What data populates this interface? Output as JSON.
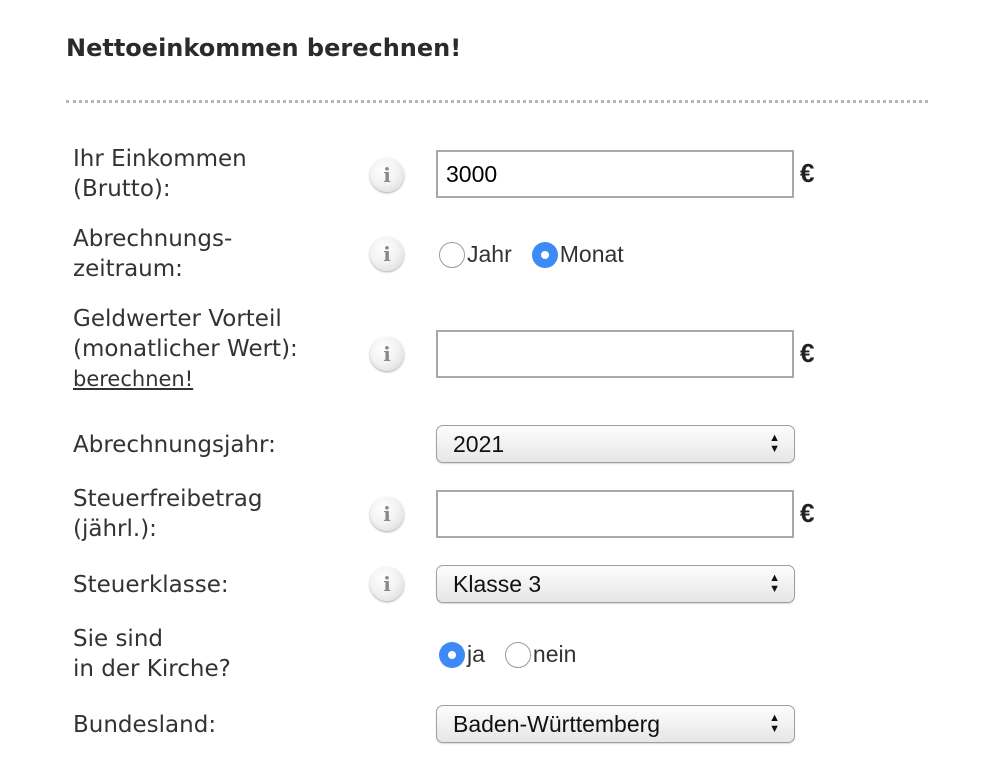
{
  "title": "Nettoeinkommen berechnen!",
  "fields": {
    "income": {
      "label_1": "Ihr Einkommen",
      "label_2": "(Brutto):",
      "value": "3000",
      "unit": "€"
    },
    "period": {
      "label_1": "Abrechnungs-",
      "label_2": "zeitraum:",
      "options": [
        "Jahr",
        "Monat"
      ],
      "selected": "Monat"
    },
    "benefit": {
      "label_1": "Geldwerter Vorteil",
      "label_2": "(monatlicher Wert):",
      "link": "berechnen!",
      "value": "",
      "unit": "€"
    },
    "year": {
      "label": "Abrechnungsjahr:",
      "value": "2021"
    },
    "allowance": {
      "label_1": "Steuerfreibetrag",
      "label_2": "(jährl.):",
      "value": "",
      "unit": "€"
    },
    "tax_class": {
      "label": "Steuerklasse:",
      "value": "Klasse 3"
    },
    "church": {
      "label_1": "Sie sind",
      "label_2": "in der Kirche?",
      "options": [
        "ja",
        "nein"
      ],
      "selected": "ja"
    },
    "state": {
      "label": "Bundesland:",
      "value": "Baden-Württemberg"
    }
  },
  "info_glyph": "i",
  "icons": {
    "info": "info-icon",
    "select_arrows": "up-down-arrows-icon"
  },
  "colors": {
    "radio_checked": "#3d8af7",
    "text": "#333333",
    "divider": "#b5b5b5"
  }
}
